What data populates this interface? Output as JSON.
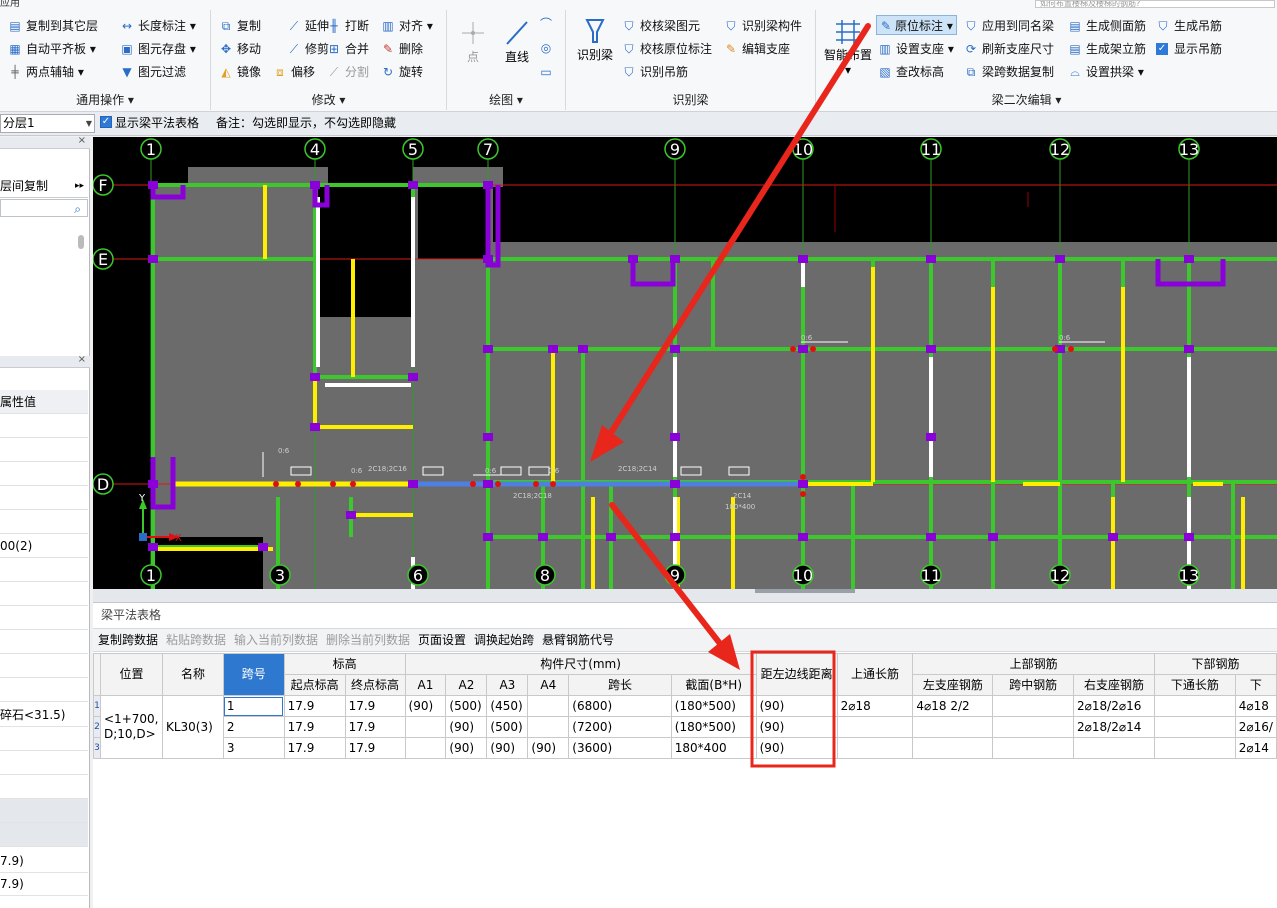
{
  "app": {
    "title": "应用",
    "search_placeholder": "如何布置楼梯及楼梯的钢筋?"
  },
  "ribbon": {
    "general": {
      "label": "通用操作",
      "items": [
        "复制到其它层",
        "长度标注",
        "自动平齐板",
        "图元存盘",
        "两点辅轴",
        "图元过滤"
      ]
    },
    "modify": {
      "label": "修改",
      "items": [
        "复制",
        "延伸",
        "打断",
        "对齐",
        "移动",
        "修剪",
        "合并",
        "删除",
        "镜像",
        "偏移",
        "分割",
        "旋转"
      ]
    },
    "draw": {
      "label": "绘图",
      "point": "点",
      "line": "直线"
    },
    "recognize": {
      "label": "识别梁",
      "big": "识别梁",
      "items": [
        "校核梁图元",
        "识别梁构件",
        "校核原位标注",
        "编辑支座",
        "识别吊筋"
      ]
    },
    "beam2": {
      "label": "梁二次编辑",
      "big": "智能布置",
      "items": [
        "原位标注",
        "应用到同名梁",
        "生成侧面筋",
        "生成吊筋",
        "设置支座",
        "刷新支座尺寸",
        "生成架立筋",
        "显示吊筋",
        "查改标高",
        "梁跨数据复制",
        "设置拱梁"
      ]
    }
  },
  "toolbar2": {
    "floor": "分层1",
    "show_table_label": "显示梁平法表格",
    "note": "备注：勾选即显示，不勾选即隐藏"
  },
  "left_panel": {
    "copy_between_floors": "层间复制",
    "property_header": "属性值",
    "rows": [
      "00(2)",
      "碎石<31.5)",
      "7.9)",
      "7.9)"
    ]
  },
  "cad": {
    "top_axes": [
      "1",
      "4",
      "5",
      "7",
      "9",
      "10",
      "11",
      "12",
      "13"
    ],
    "bottom_axes": [
      "1",
      "3",
      "6",
      "8",
      "9",
      "10",
      "11",
      "12",
      "13"
    ],
    "side_axes": [
      "F",
      "E",
      "D"
    ],
    "labels": [
      "0:6",
      "0:6",
      "0:6",
      "0:6",
      "0:6",
      "0:6",
      "2C18;2C16",
      "2C18;2C14",
      "2C18;2C18",
      "2C14",
      "180*400"
    ],
    "coord_y": "Y",
    "coord_x": "X"
  },
  "table_panel": {
    "title": "梁平法表格",
    "toolbar": [
      "复制跨数据",
      "粘贴跨数据",
      "输入当前列数据",
      "删除当前列数据",
      "页面设置",
      "调换起始跨",
      "悬臂钢筋代号"
    ],
    "toolbar_disabled": [
      false,
      true,
      true,
      true,
      false,
      false,
      false
    ],
    "headers": {
      "position": "位置",
      "name": "名称",
      "span": "跨号",
      "elevation": "标高",
      "start_elev": "起点标高",
      "end_elev": "终点标高",
      "size_group": "构件尺寸(mm)",
      "a1": "A1",
      "a2": "A2",
      "a3": "A3",
      "a4": "A4",
      "span_len": "跨长",
      "section": "截面(B*H)",
      "offset": "距左边线距离",
      "top_through": "上通长筋",
      "top_rebar": "上部钢筋",
      "left_seat": "左支座钢筋",
      "mid_span": "跨中钢筋",
      "right_seat": "右支座钢筋",
      "bottom_rebar": "下部钢筋",
      "bottom_through": "下通长筋",
      "bottom_partial": "下"
    },
    "position_value": "<1+700, D;10,D>",
    "name_value": "KL30(3)",
    "rows": [
      {
        "no": "1",
        "span": "1",
        "start": "17.9",
        "end": "17.9",
        "a1": "(90)",
        "a2": "(500)",
        "a3": "(450)",
        "a4": "",
        "len": "(6800)",
        "section": "(180*500)",
        "offset": "(90)",
        "top_through": "2⌀18",
        "left_seat": "4⌀18 2/2",
        "mid": "",
        "right_seat": "2⌀18/2⌀16",
        "bottom_through": "",
        "bottom": "4⌀18"
      },
      {
        "no": "2",
        "span": "2",
        "start": "17.9",
        "end": "17.9",
        "a1": "",
        "a2": "(90)",
        "a3": "(500)",
        "a4": "",
        "len": "(7200)",
        "section": "(180*500)",
        "offset": "(90)",
        "top_through": "",
        "left_seat": "",
        "mid": "",
        "right_seat": "2⌀18/2⌀14",
        "bottom_through": "",
        "bottom": "2⌀16/"
      },
      {
        "no": "3",
        "span": "3",
        "start": "17.9",
        "end": "17.9",
        "a1": "",
        "a2": "(90)",
        "a3": "(90)",
        "a4": "(90)",
        "len": "(3600)",
        "section": "180*400",
        "offset": "(90)",
        "top_through": "",
        "left_seat": "",
        "mid": "",
        "right_seat": "",
        "bottom_through": "",
        "bottom": "2⌀14"
      }
    ]
  },
  "colors": {
    "annotation": "#e8261c",
    "selected_header": "#2f78d0",
    "wall_green": "#3cc82c",
    "beam_yellow": "#ffee00",
    "column_purple": "#8a00d8",
    "axis_red": "#d81818"
  }
}
